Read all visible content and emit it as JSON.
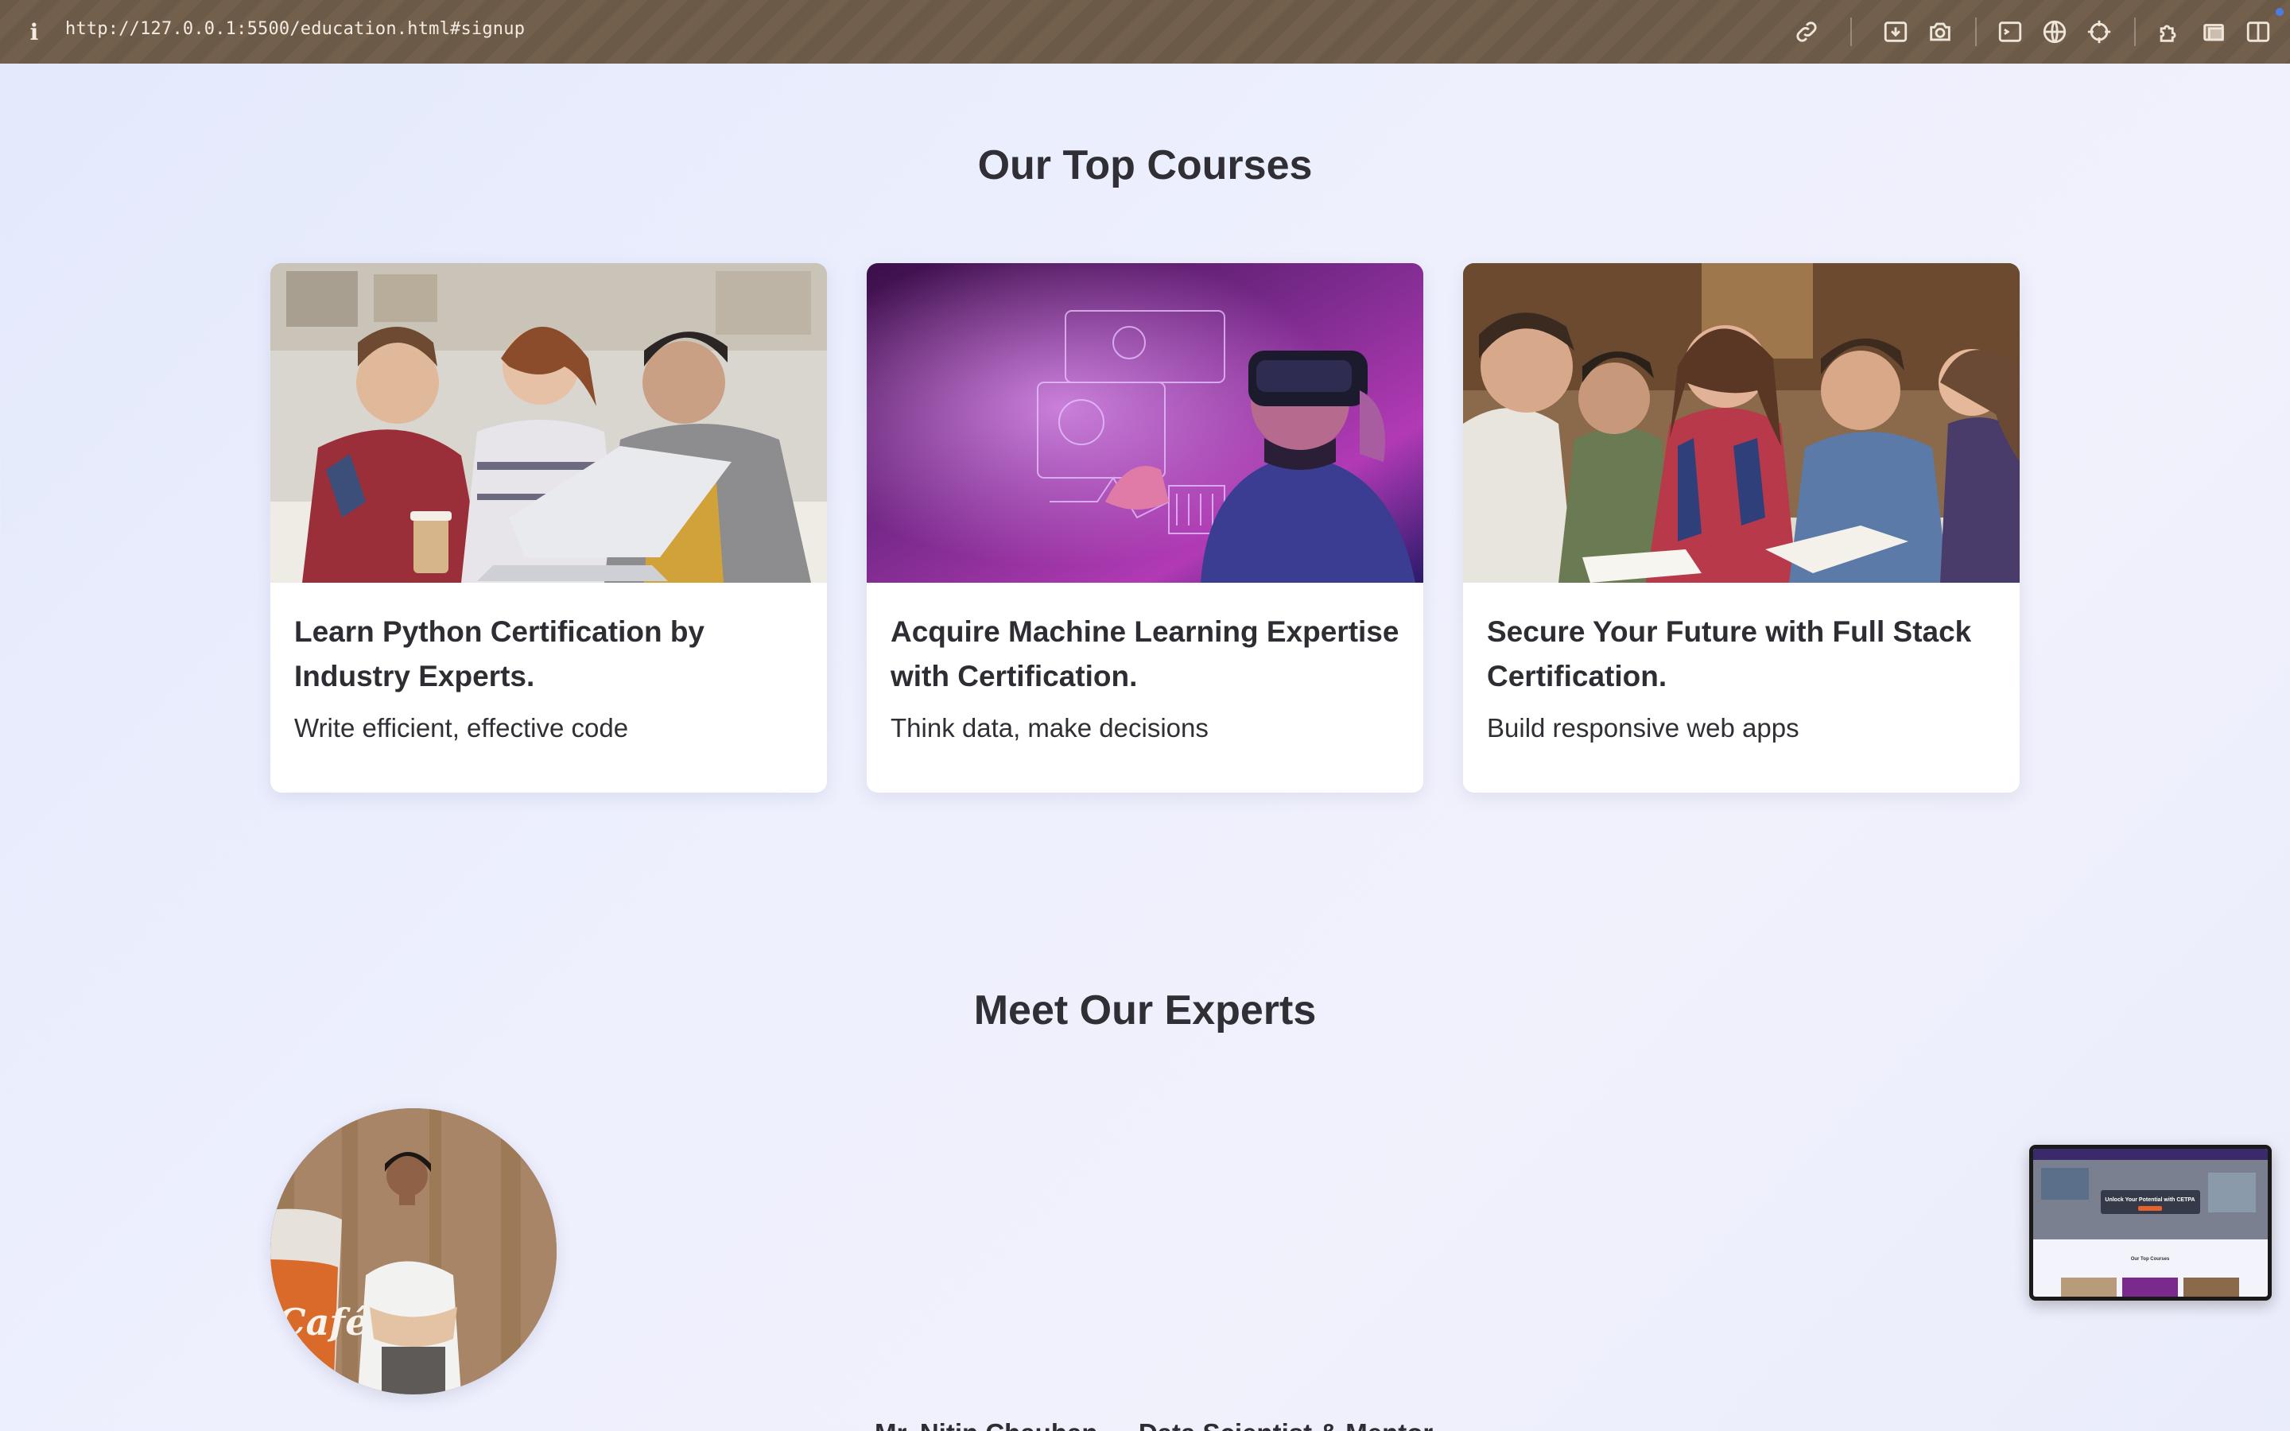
{
  "browser": {
    "url": "http://127.0.0.1:5500/education.html#signup",
    "info_icon": "i",
    "toolbar_icons": [
      "link-icon",
      "download-icon",
      "camera-icon",
      "terminal-icon",
      "globe-icon",
      "crosshair-icon",
      "extensions-icon",
      "window-icon",
      "split-view-icon"
    ]
  },
  "courses": {
    "heading": "Our Top Courses",
    "items": [
      {
        "title": "Learn Python Certification by Industry Experts.",
        "desc": "Write efficient, effective code",
        "image": "students-laptop-photo"
      },
      {
        "title": "Acquire Machine Learning Expertise with Certification.",
        "desc": "Think data, make decisions",
        "image": "vr-headset-photo"
      },
      {
        "title": "Secure Your Future with Full Stack Certification.",
        "desc": "Build responsive web apps",
        "image": "study-group-photo"
      }
    ]
  },
  "experts": {
    "heading": "Meet Our Experts",
    "first": {
      "name_line": "Mr. Nitin Chauhan — Data Scientist & Mentor",
      "photo": "expert-portrait-photo"
    }
  },
  "preview": {
    "hero_text": "Unlock Your Potential with CETPA",
    "sub_heading": "Our Top Courses"
  },
  "colors": {
    "topbar": "#6c5a48",
    "text": "#2d2d33",
    "card_bg": "#ffffff"
  }
}
